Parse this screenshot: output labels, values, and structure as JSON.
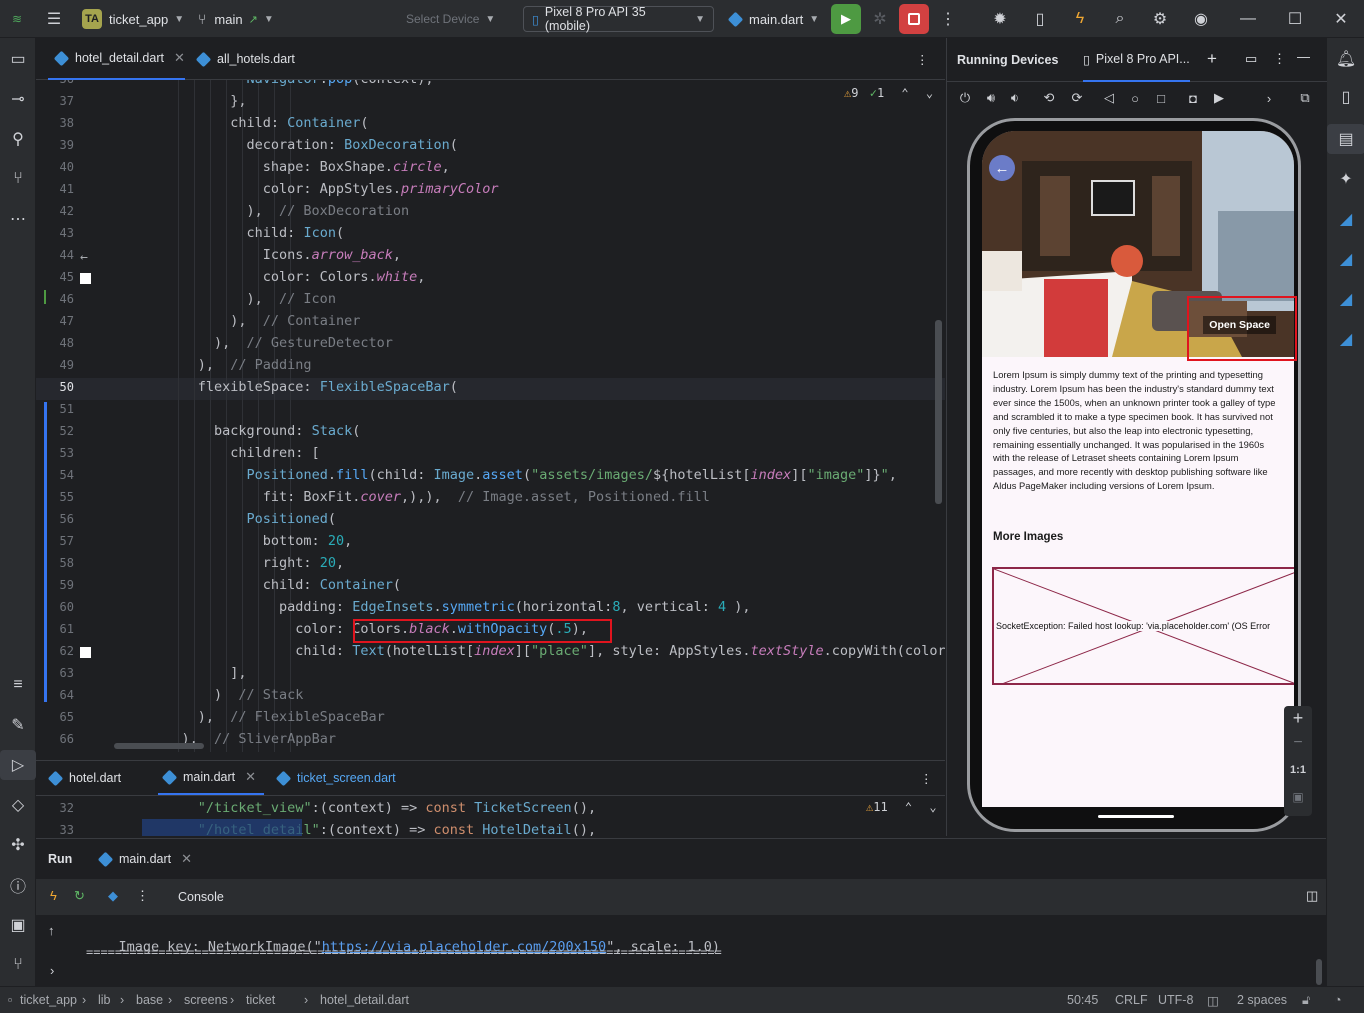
{
  "titlebar": {
    "project_badge": "TA",
    "project_name": "ticket_app",
    "branch": "main",
    "select_device": "Select Device",
    "device": "Pixel 8 Pro API 35 (mobile)",
    "run_config": "main.dart"
  },
  "editor": {
    "tabs": [
      {
        "label": "hotel_detail.dart",
        "active": true
      },
      {
        "label": "all_hotels.dart",
        "active": false
      }
    ],
    "warnings": "9",
    "weak_warnings": "1",
    "lines": [
      {
        "n": "36",
        "html": "            <span class=\"ty\">Navigator</span>.<span class=\"fn\">pop</span>(context),"
      },
      {
        "n": "37",
        "html": "          },"
      },
      {
        "n": "38",
        "html": "          child: <span class=\"ty\">Container</span>("
      },
      {
        "n": "39",
        "html": "            decoration: <span class=\"ty\">BoxDecoration</span>("
      },
      {
        "n": "40",
        "html": "              shape: BoxShape.<span class=\"prop\">circle</span>,"
      },
      {
        "n": "41",
        "html": "              color: AppStyles.<span class=\"prop\">primaryColor</span>"
      },
      {
        "n": "42",
        "html": "            ),  <span class=\"cm\">// BoxDecoration</span>"
      },
      {
        "n": "43",
        "html": "            child: <span class=\"ty\">Icon</span>("
      },
      {
        "n": "44",
        "html": "              Icons.<span class=\"prop\">arrow_back</span>,"
      },
      {
        "n": "45",
        "html": "              color: Colors.<span class=\"prop\">white</span>,"
      },
      {
        "n": "46",
        "html": "            ),  <span class=\"cm\">// Icon</span>"
      },
      {
        "n": "47",
        "html": "          ),  <span class=\"cm\">// Container</span>"
      },
      {
        "n": "48",
        "html": "        ),  <span class=\"cm\">// GestureDetector</span>"
      },
      {
        "n": "49",
        "html": "      ),  <span class=\"cm\">// Padding</span>"
      },
      {
        "n": "50",
        "html": "      flexibleSpace: <span class=\"ty\">FlexibleSpaceBar</span>("
      },
      {
        "n": "51",
        "html": ""
      },
      {
        "n": "52",
        "html": "        background: <span class=\"ty\">Stack</span>("
      },
      {
        "n": "53",
        "html": "          children: ["
      },
      {
        "n": "54",
        "html": "            <span class=\"ty\">Positioned</span>.<span class=\"fn\">fill</span>(child: <span class=\"ty\">Image</span>.<span class=\"fn\">asset</span>(<span class=\"str\">\"assets/images/</span>${hotelList[<span class=\"prop\">index</span>][<span class=\"str\">\"image\"</span>]}<span class=\"str\">\"</span>,"
      },
      {
        "n": "55",
        "html": "              fit: BoxFit.<span class=\"prop\">cover</span>,),),  <span class=\"cm\">// Image.asset, Positioned.fill</span>"
      },
      {
        "n": "56",
        "html": "            <span class=\"ty\">Positioned</span>("
      },
      {
        "n": "57",
        "html": "              bottom: <span class=\"num\">20</span>,"
      },
      {
        "n": "58",
        "html": "              right: <span class=\"num\">20</span>,"
      },
      {
        "n": "59",
        "html": "              child: <span class=\"ty\">Container</span>("
      },
      {
        "n": "60",
        "html": "                padding: <span class=\"ty\">EdgeInsets</span>.<span class=\"fn\">symmetric</span>(horizontal:<span class=\"num\">8</span>, vertical: <span class=\"num\">4</span> ),"
      },
      {
        "n": "61",
        "html": "                  color: Colors.<span class=\"prop\">black</span>.<span class=\"fn\">withOpacity</span>(<span class=\"num\">.5</span>),"
      },
      {
        "n": "62",
        "html": "                  child: <span class=\"ty\">Text</span>(hotelList[<span class=\"prop\">index</span>][<span class=\"str\">\"place\"</span>], style: AppStyles.<span class=\"prop\">textStyle</span>.copyWith(color"
      },
      {
        "n": "63",
        "html": "          ],"
      },
      {
        "n": "64",
        "html": "        )  <span class=\"cm\">// Stack</span>"
      },
      {
        "n": "65",
        "html": "      ),  <span class=\"cm\">// FlexibleSpaceBar</span>"
      },
      {
        "n": "66",
        "html": "    ),  <span class=\"cm\">// SliverAppBar</span>"
      }
    ]
  },
  "bottom_editor": {
    "tabs": [
      {
        "label": "hotel.dart",
        "active": false
      },
      {
        "label": "main.dart",
        "active": true
      },
      {
        "label": "ticket_screen.dart",
        "active": false
      }
    ],
    "warnings": "11",
    "lines": [
      {
        "n": "32",
        "html": "      <span class=\"str\">\"/ticket_view\"</span>:(context) => <span class=\"kw\">const</span> <span class=\"ty\">TicketScreen</span>(),"
      },
      {
        "n": "33",
        "html": "      <span class=\"str\">\"/hotel_detail\"</span>:(context) => <span class=\"kw\">const</span> <span class=\"ty\">HotelDetail</span>(),"
      }
    ]
  },
  "run": {
    "title": "Run",
    "tab": "main.dart",
    "console_tab": "Console",
    "line1_prefix": "Image key: NetworkImage(\"",
    "line1_link": "https://via.placeholder.com/200x150",
    "line1_suffix": "\", scale: 1.0)",
    "line2": "========================================================================================"
  },
  "devices": {
    "title": "Running Devices",
    "tab": "Pixel 8 Pro API..."
  },
  "app": {
    "place": "Open Space",
    "description": "Lorem Ipsum is simply dummy text of the printing and typesetting industry. Lorem Ipsum has been the industry's standard dummy text ever since the 1500s, when an unknown printer took a galley of type and scrambled it to make a type specimen book. It has survived not only five centuries, but also the leap into electronic typesetting, remaining essentially unchanged. It was popularised in the 1960s with the release of Letraset sheets containing Lorem Ipsum passages, and more recently with desktop publishing software like Aldus PageMaker including versions of Lorem Ipsum.",
    "more_images": "More Images",
    "error": "SocketException: Failed host lookup: 'via.placeholder.com' (OS Error"
  },
  "zoom": {
    "one_to_one": "1:1"
  },
  "statusbar": {
    "crumbs": [
      "ticket_app",
      "lib",
      "base",
      "screens",
      "ticket",
      "hotel_detail.dart"
    ],
    "position": "50:45",
    "line_sep": "CRLF",
    "encoding": "UTF-8",
    "indent": "2 spaces"
  },
  "colors": {
    "accent": "#3574f0",
    "run_green": "#4e9a42",
    "stop_red": "#d24141",
    "annotation": "#e0141e"
  }
}
